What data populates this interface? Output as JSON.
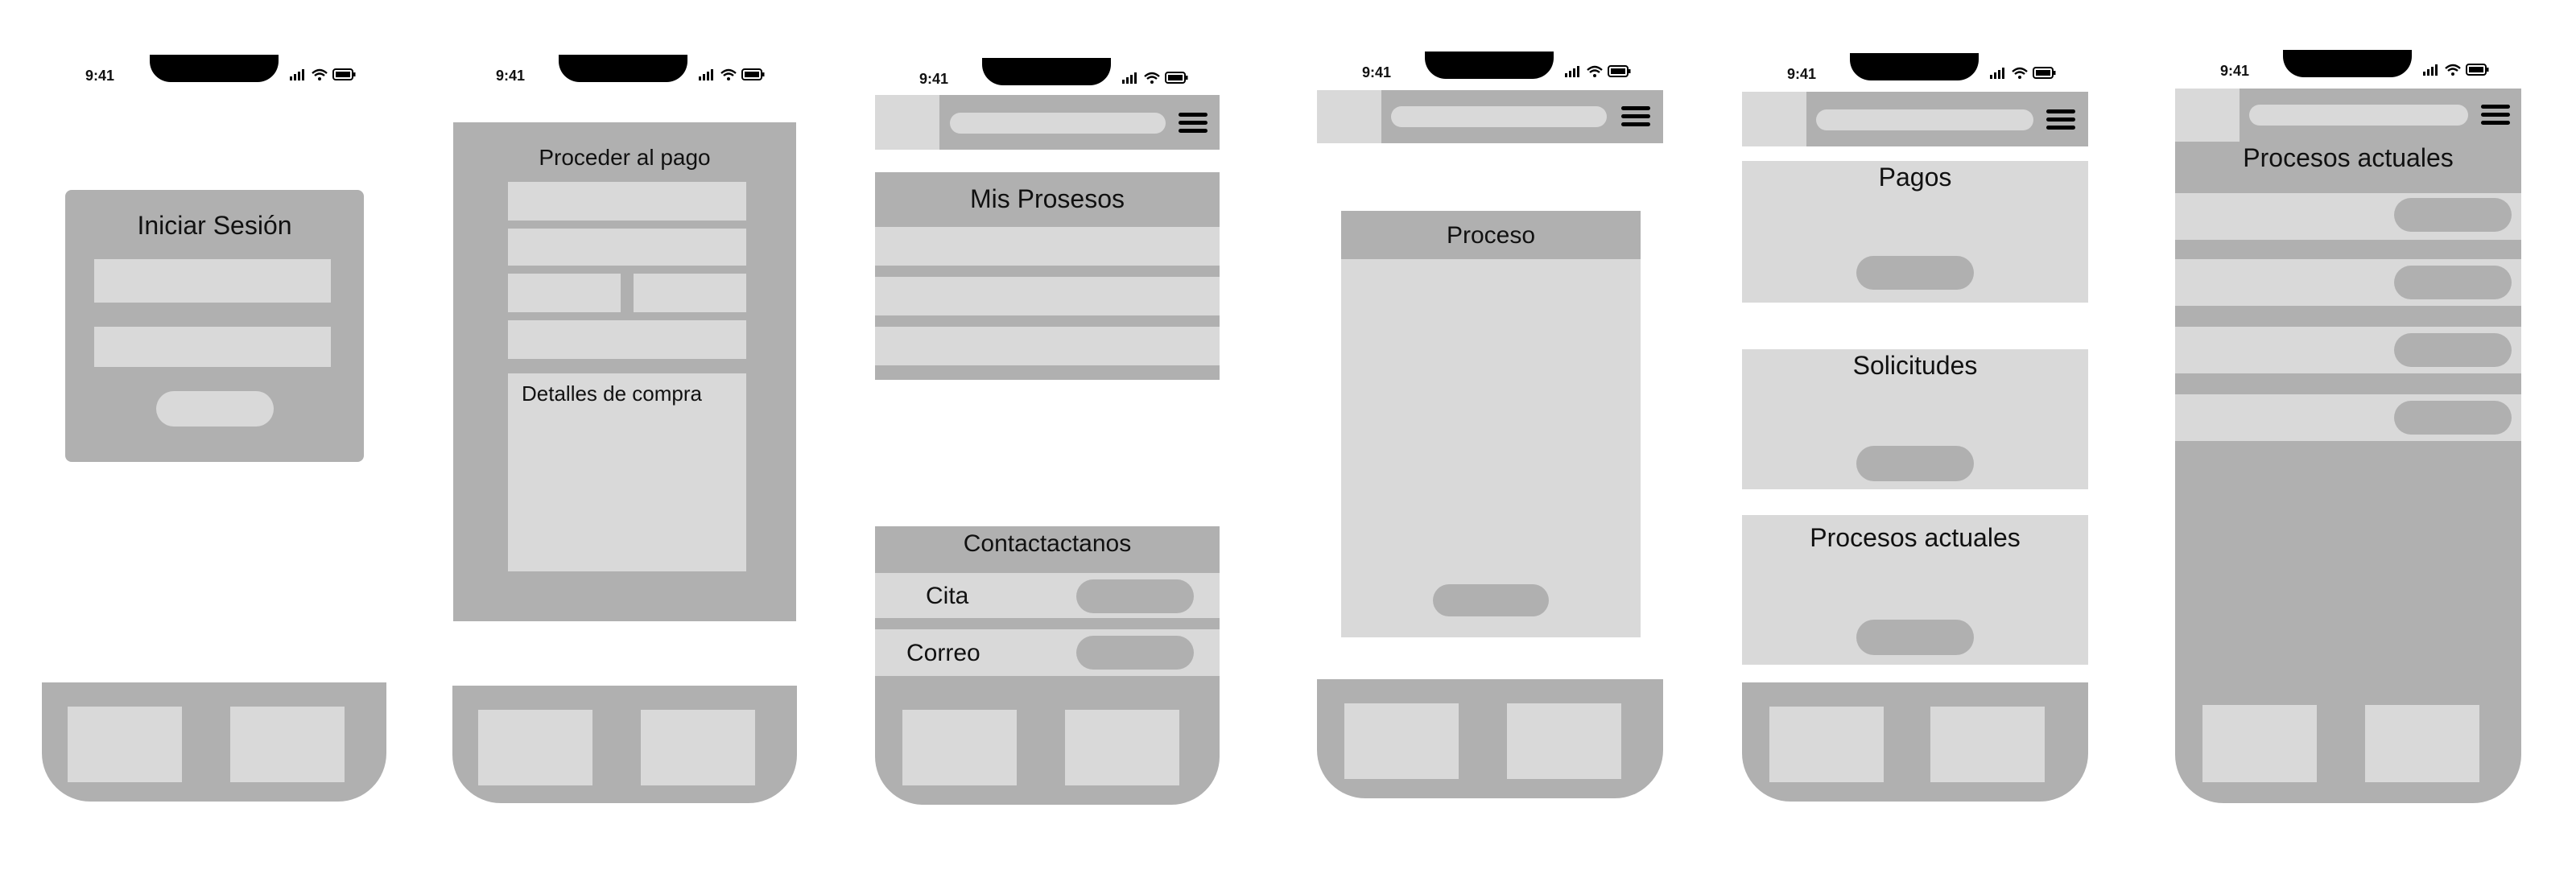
{
  "status_time": "9:41",
  "screens": {
    "login": {
      "title": "Iniciar Sesión"
    },
    "payment": {
      "title": "Proceder al pago",
      "details_label": "Detalles de compra"
    },
    "my_processes": {
      "title": "Mis Prosesos",
      "contact_title": "Contactactanos",
      "contact_items": [
        "Cita",
        "Correo"
      ]
    },
    "process": {
      "title": "Proceso"
    },
    "dashboard": {
      "cards": [
        "Pagos",
        "Solicitudes",
        "Procesos actuales"
      ]
    },
    "current_processes": {
      "title": "Procesos actuales"
    }
  },
  "colors": {
    "light_gray": "#d9d9d9",
    "mid_gray": "#b0b0b0",
    "black": "#000000"
  },
  "icons": [
    "signal-icon",
    "wifi-icon",
    "battery-icon",
    "hamburger-menu-icon"
  ]
}
